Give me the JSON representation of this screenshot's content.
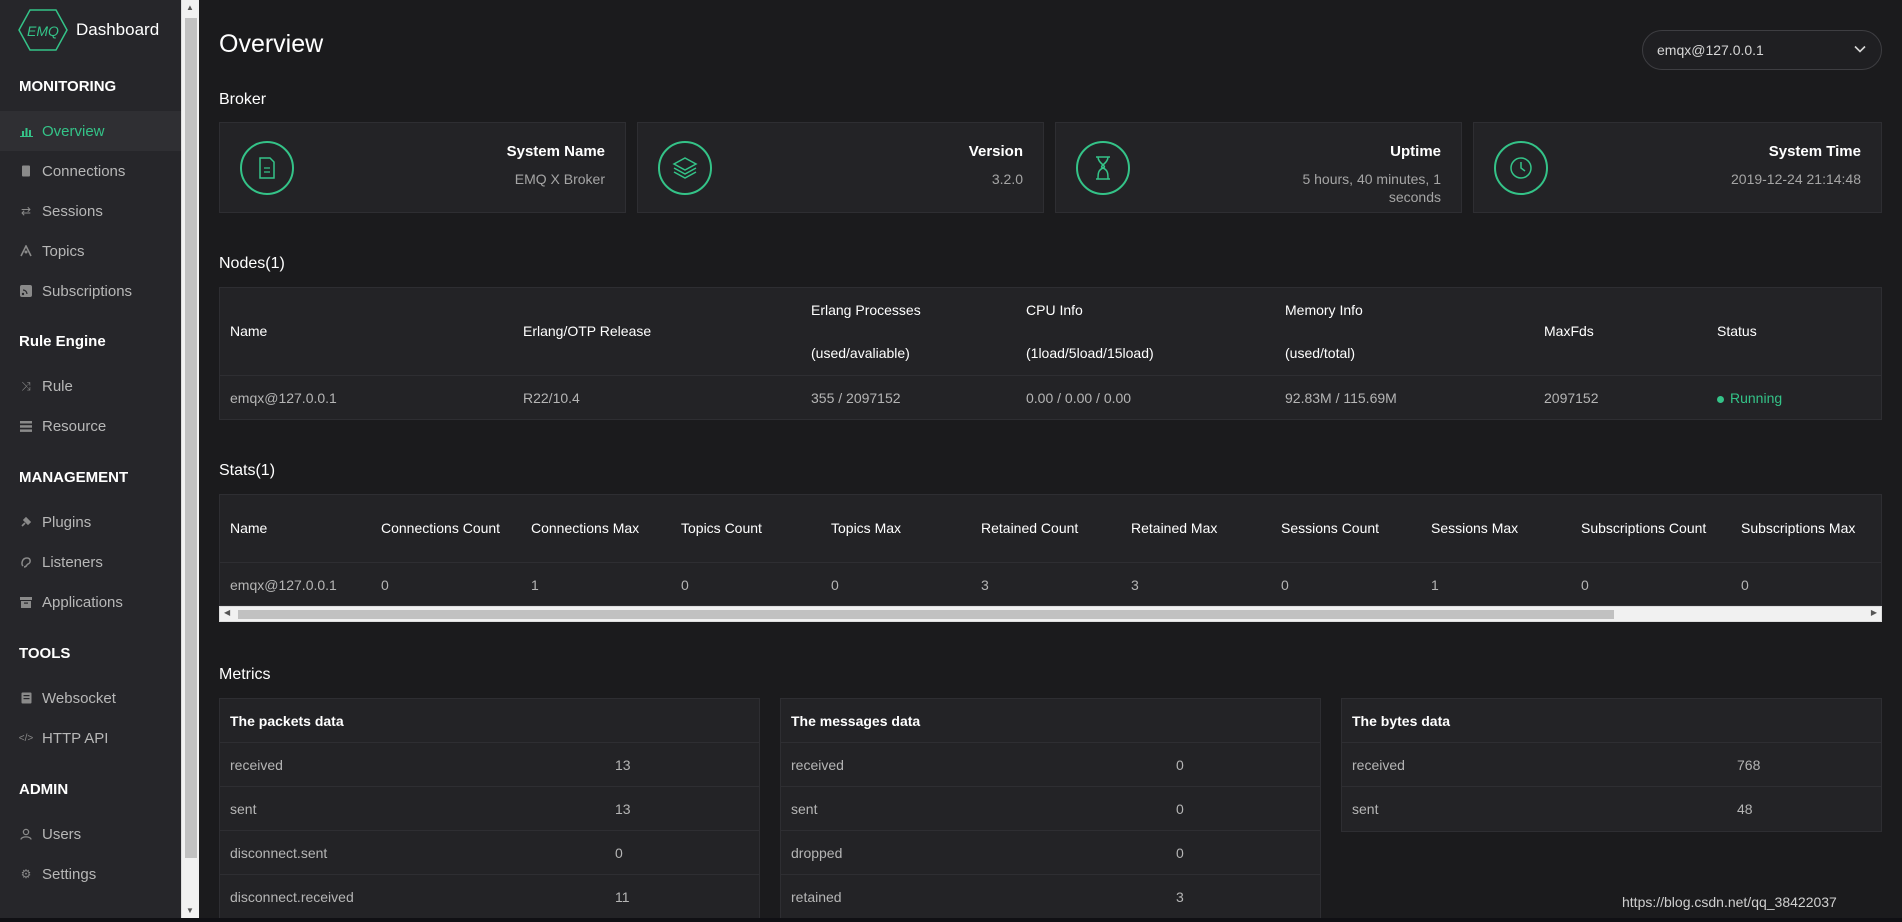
{
  "brand": {
    "logo_text": "EMQ",
    "name": "Dashboard"
  },
  "sidebar": {
    "sections": [
      {
        "title": "MONITORING",
        "items": [
          {
            "label": "Overview",
            "icon": "bar-chart-icon",
            "active": true
          },
          {
            "label": "Connections",
            "icon": "device-icon"
          },
          {
            "label": "Sessions",
            "icon": "swap-icon"
          },
          {
            "label": "Topics",
            "icon": "topic-icon"
          },
          {
            "label": "Subscriptions",
            "icon": "rss-icon"
          }
        ]
      },
      {
        "title": "Rule Engine",
        "items": [
          {
            "label": "Rule",
            "icon": "shuffle-icon"
          },
          {
            "label": "Resource",
            "icon": "list-icon"
          }
        ]
      },
      {
        "title": "MANAGEMENT",
        "items": [
          {
            "label": "Plugins",
            "icon": "plug-icon"
          },
          {
            "label": "Listeners",
            "icon": "ear-icon"
          },
          {
            "label": "Applications",
            "icon": "box-icon"
          }
        ]
      },
      {
        "title": "TOOLS",
        "items": [
          {
            "label": "Websocket",
            "icon": "websocket-icon"
          },
          {
            "label": "HTTP API",
            "icon": "code-icon"
          }
        ]
      },
      {
        "title": "ADMIN",
        "items": [
          {
            "label": "Users",
            "icon": "user-icon"
          },
          {
            "label": "Settings",
            "icon": "gear-icon"
          }
        ]
      }
    ]
  },
  "header": {
    "title": "Overview",
    "node_select": "emqx@127.0.0.1"
  },
  "broker": {
    "title": "Broker",
    "cards": [
      {
        "label": "System Name",
        "value": "EMQ X Broker",
        "icon": "document-icon"
      },
      {
        "label": "Version",
        "value": "3.2.0",
        "icon": "layers-icon"
      },
      {
        "label": "Uptime",
        "value": "5 hours, 40 minutes, 1 seconds",
        "icon": "hourglass-icon"
      },
      {
        "label": "System Time",
        "value": "2019-12-24 21:14:48",
        "icon": "clock-icon"
      }
    ]
  },
  "nodes": {
    "title": "Nodes(1)",
    "headers": {
      "name": "Name",
      "otp": "Erlang/OTP Release",
      "proc_1": "Erlang Processes",
      "proc_2": "(used/avaliable)",
      "cpu_1": "CPU Info",
      "cpu_2": "(1load/5load/15load)",
      "mem_1": "Memory Info",
      "mem_2": "(used/total)",
      "maxfds": "MaxFds",
      "status": "Status"
    },
    "rows": [
      {
        "name": "emqx@127.0.0.1",
        "otp": "R22/10.4",
        "proc": "355 / 2097152",
        "cpu": "0.00 / 0.00 / 0.00",
        "mem": "92.83M / 115.69M",
        "maxfds": "2097152",
        "status": "Running"
      }
    ]
  },
  "stats": {
    "title": "Stats(1)",
    "headers": [
      "Name",
      "Connections Count",
      "Connections Max",
      "Topics Count",
      "Topics Max",
      "Retained Count",
      "Retained Max",
      "Sessions Count",
      "Sessions Max",
      "Subscriptions Count",
      "Subscriptions Max"
    ],
    "rows": [
      [
        "emqx@127.0.0.1",
        "0",
        "1",
        "0",
        "0",
        "3",
        "3",
        "0",
        "1",
        "0",
        "0"
      ]
    ]
  },
  "metrics": {
    "title": "Metrics",
    "panels": [
      {
        "title": "The packets data",
        "rows": [
          {
            "k": "received",
            "v": "13"
          },
          {
            "k": "sent",
            "v": "13"
          },
          {
            "k": "disconnect.sent",
            "v": "0"
          },
          {
            "k": "disconnect.received",
            "v": "11"
          }
        ]
      },
      {
        "title": "The messages data",
        "rows": [
          {
            "k": "received",
            "v": "0"
          },
          {
            "k": "sent",
            "v": "0"
          },
          {
            "k": "dropped",
            "v": "0"
          },
          {
            "k": "retained",
            "v": "3"
          }
        ]
      },
      {
        "title": "The bytes data",
        "rows": [
          {
            "k": "received",
            "v": "768"
          },
          {
            "k": "sent",
            "v": "48"
          }
        ]
      }
    ]
  },
  "watermark": "https://blog.csdn.net/qq_38422037",
  "colors": {
    "accent": "#34c388",
    "background": "#1b1b1d",
    "sidebar": "#26262a",
    "panel": "#232326"
  }
}
